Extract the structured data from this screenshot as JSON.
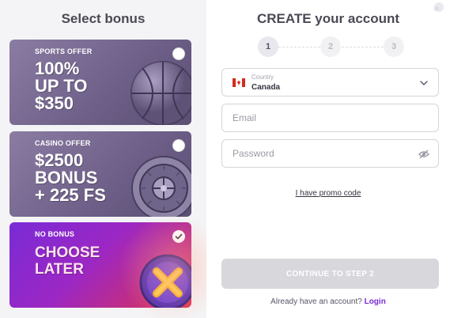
{
  "left": {
    "title": "Select bonus",
    "cards": [
      {
        "tag": "SPORTS OFFER",
        "headline": "100%\nUP TO\n$350",
        "selected": false,
        "art": "basketball-icon"
      },
      {
        "tag": "CASINO OFFER",
        "headline": "$2500\nBONUS\n+ 225 FS",
        "selected": false,
        "art": "roulette-icon"
      },
      {
        "tag": "NO BONUS",
        "headline": "CHOOSE\nLATER",
        "selected": true,
        "art": "x-mark-icon"
      }
    ]
  },
  "right": {
    "title": "CREATE your account",
    "steps": [
      "1",
      "2",
      "3"
    ],
    "active_step": 1,
    "country": {
      "label": "Country",
      "value": "Canada",
      "flag": "canada-flag-icon"
    },
    "email": {
      "placeholder": "Email",
      "value": ""
    },
    "password": {
      "placeholder": "Password",
      "value": ""
    },
    "promo_link": "I have promo code",
    "continue_label": "CONTINUE TO STEP 2",
    "login_prompt": "Already have an account?",
    "login_link": "Login"
  },
  "colors": {
    "accent": "#7a2bd6",
    "button_disabled": "#d7d7dc",
    "card_muted": "#6c5e86"
  }
}
